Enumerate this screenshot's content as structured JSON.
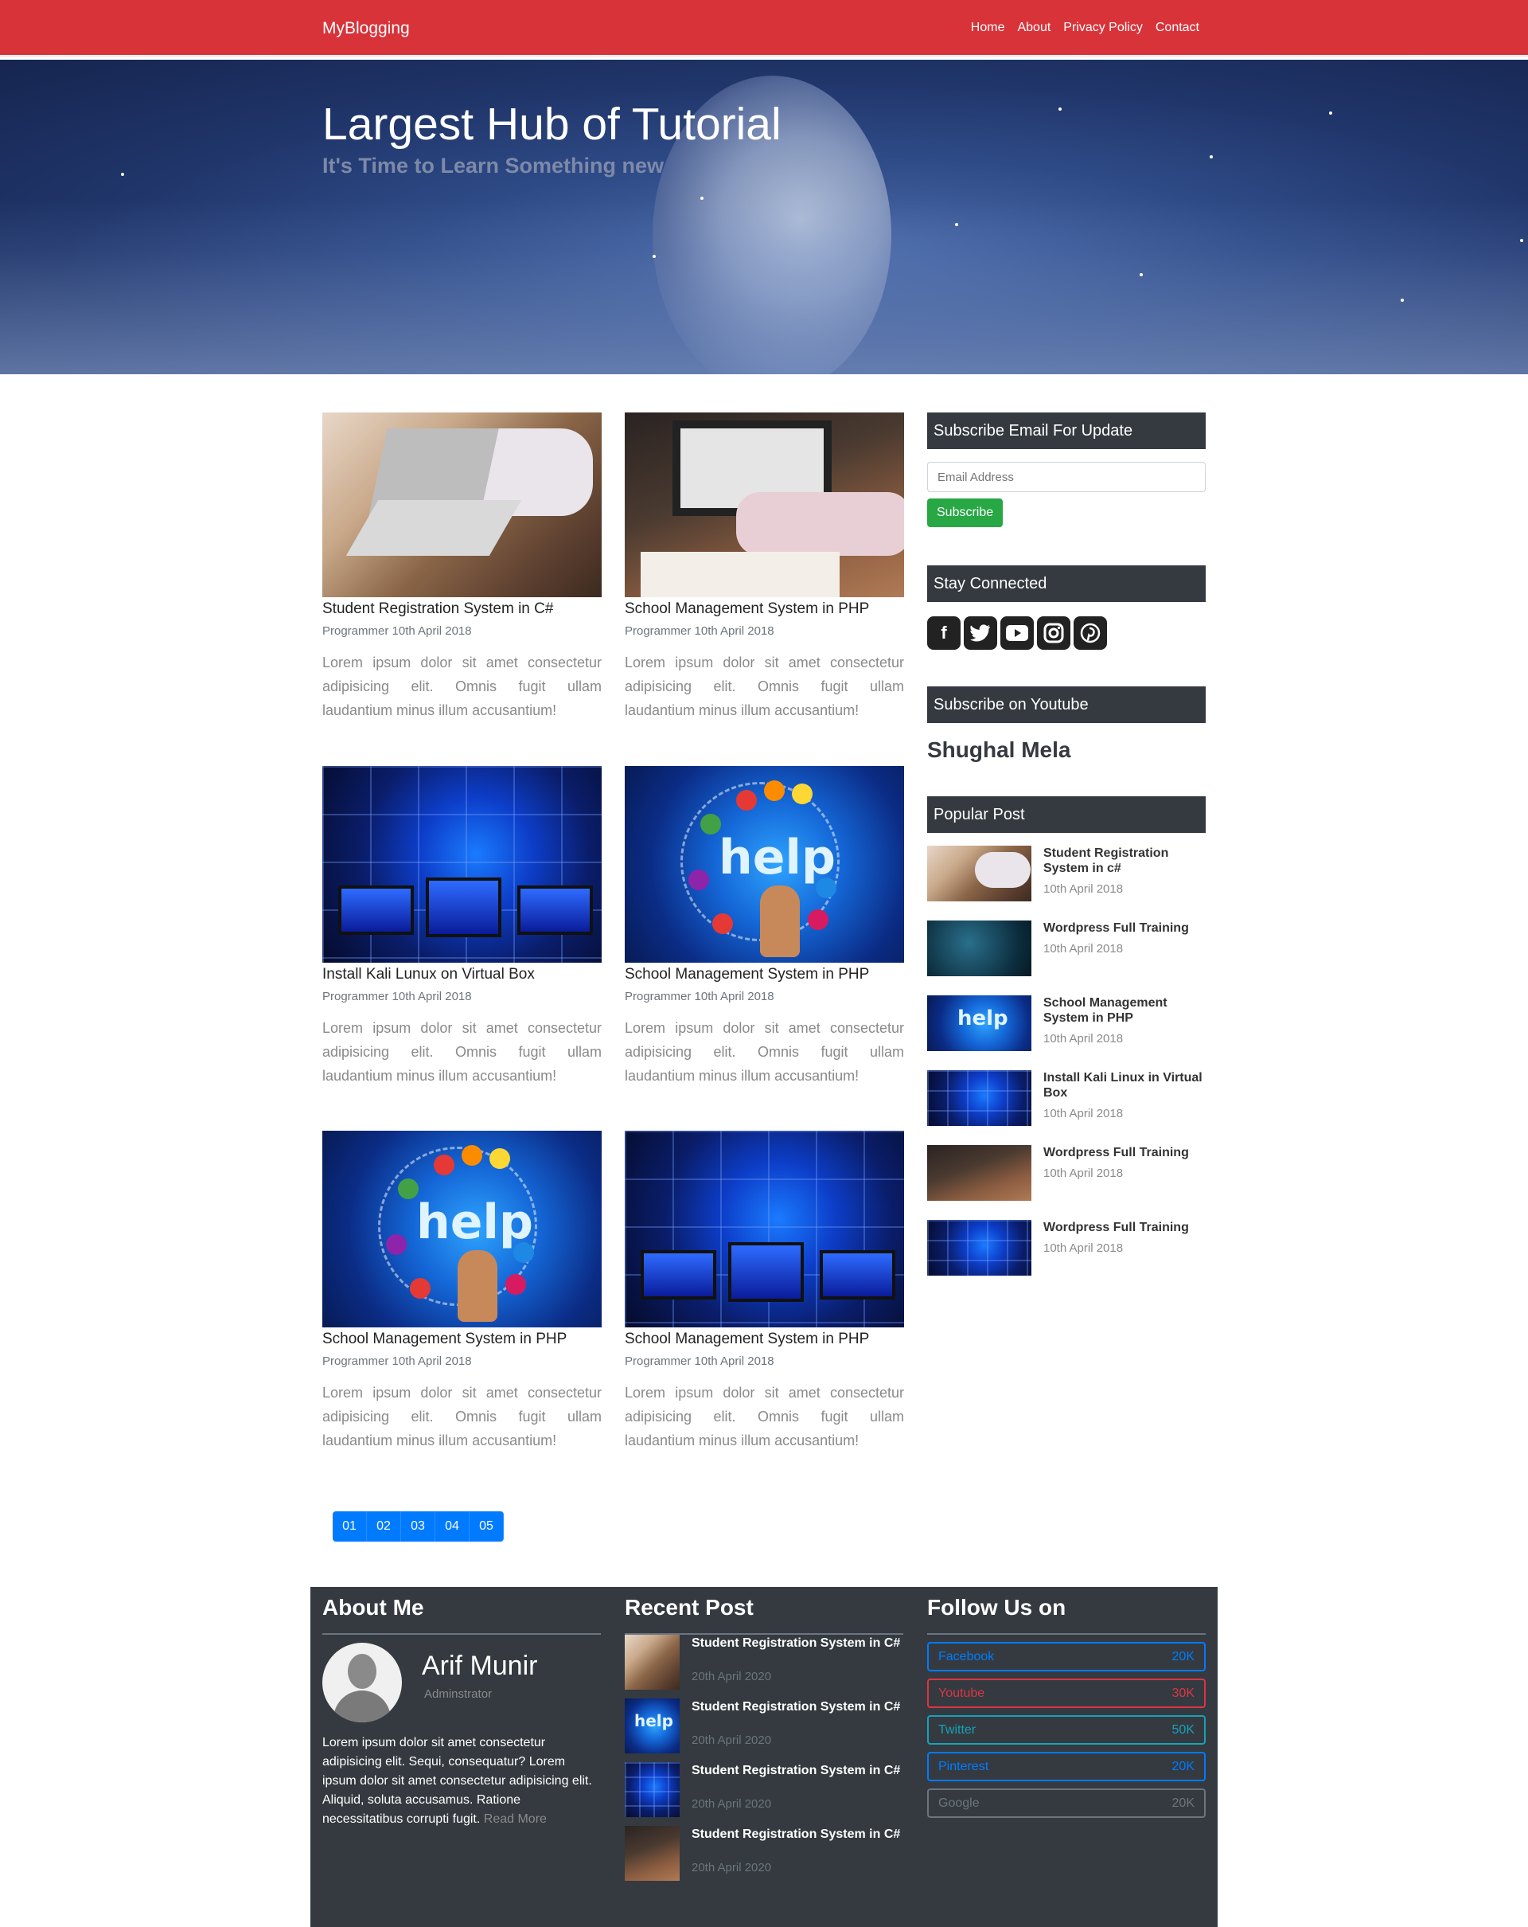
{
  "nav": {
    "brand": "MyBlogging",
    "links": [
      "Home",
      "About",
      "Privacy Policy",
      "Contact"
    ]
  },
  "hero": {
    "title": "Largest Hub of Tutorial",
    "subtitle": "It's Time to Learn Something new"
  },
  "posts": [
    {
      "title": "Student Registration System in C#",
      "meta": "Programmer 10th April 2018",
      "excerpt": "Lorem ipsum dolor sit amet consectetur adipisicing elit. Omnis fugit ullam laudantium minus illum accusantium!"
    },
    {
      "title": "School Management System in PHP",
      "meta": "Programmer 10th April 2018",
      "excerpt": "Lorem ipsum dolor sit amet consectetur adipisicing elit. Omnis fugit ullam laudantium minus illum accusantium!"
    },
    {
      "title": "Install Kali Lunux on Virtual Box",
      "meta": "Programmer 10th April 2018",
      "excerpt": "Lorem ipsum dolor sit amet consectetur adipisicing elit. Omnis fugit ullam laudantium minus illum accusantium!"
    },
    {
      "title": "School Management System in PHP",
      "meta": "Programmer 10th April 2018",
      "excerpt": "Lorem ipsum dolor sit amet consectetur adipisicing elit. Omnis fugit ullam laudantium minus illum accusantium!"
    },
    {
      "title": "School Management System in PHP",
      "meta": "Programmer 10th April 2018",
      "excerpt": "Lorem ipsum dolor sit amet consectetur adipisicing elit. Omnis fugit ullam laudantium minus illum accusantium!"
    },
    {
      "title": "School Management System in PHP",
      "meta": "Programmer 10th April 2018",
      "excerpt": "Lorem ipsum dolor sit amet consectetur adipisicing elit. Omnis fugit ullam laudantium minus illum accusantium!"
    }
  ],
  "pagination": [
    "01",
    "02",
    "03",
    "04",
    "05"
  ],
  "sidebar": {
    "subscribe_heading": "Subscribe Email For Update",
    "email_placeholder": "Email Address",
    "subscribe_button": "Subscribe",
    "stay_connected_heading": "Stay Connected",
    "social_icons": [
      "facebook-icon",
      "twitter-icon",
      "youtube-icon",
      "instagram-icon",
      "pinterest-icon"
    ],
    "youtube_heading": "Subscribe on Youtube",
    "channel_name": "Shughal Mela",
    "popular_heading": "Popular Post",
    "popular": [
      {
        "title": "Student Registration System in c#",
        "date": "10th April 2018"
      },
      {
        "title": "Wordpress Full Training",
        "date": "10th April 2018"
      },
      {
        "title": "School Management System in PHP",
        "date": "10th April 2018"
      },
      {
        "title": "Install Kali Linux in Virtual Box",
        "date": "10th April 2018"
      },
      {
        "title": "Wordpress Full Training",
        "date": "10th April 2018"
      },
      {
        "title": "Wordpress Full Training",
        "date": "10th April 2018"
      }
    ]
  },
  "footer": {
    "about_heading": "About Me",
    "author_name": "Arif Munir",
    "author_role": "Adminstrator",
    "about_text": "Lorem ipsum dolor sit amet consectetur adipisicing elit. Sequi, consequatur? Lorem ipsum dolor sit amet consectetur adipisicing elit. Aliquid, soluta accusamus. Ratione necessitatibus corrupti fugit.",
    "read_more": "Read More",
    "recent_heading": "Recent Post",
    "recent": [
      {
        "title": "Student Registration System in C#",
        "date": "20th April 2020"
      },
      {
        "title": "Student Registration System in C#",
        "date": "20th April 2020"
      },
      {
        "title": "Student Registration System in C#",
        "date": "20th April 2020"
      },
      {
        "title": "Student Registration System in C#",
        "date": "20th April 2020"
      }
    ],
    "follow_heading": "Follow Us on",
    "follow": [
      {
        "name": "Facebook",
        "count": "20K",
        "color": "#007bff"
      },
      {
        "name": "Youtube",
        "count": "30K",
        "color": "#dc3545"
      },
      {
        "name": "Twitter",
        "count": "50K",
        "color": "#17a2b8"
      },
      {
        "name": "Pinterest",
        "count": "20K",
        "color": "#007bff"
      },
      {
        "name": "Google",
        "count": "20K",
        "color": "#6c757d"
      }
    ]
  },
  "colors": {
    "navbar": "#d9333a",
    "dark": "#343a40",
    "primary": "#007bff",
    "success": "#28a745"
  }
}
